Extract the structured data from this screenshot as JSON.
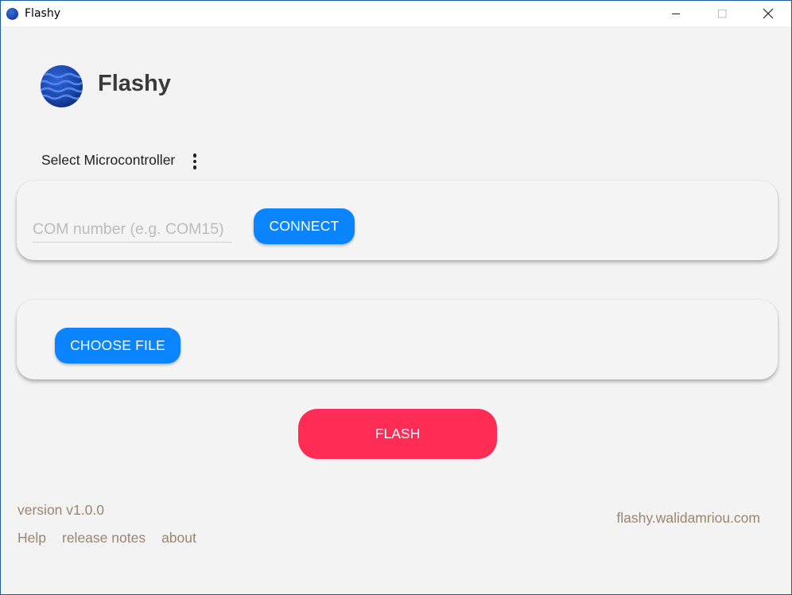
{
  "window": {
    "title": "Flashy",
    "controls": {
      "minimize_icon": "minimize-icon",
      "maximize_icon": "maximize-icon",
      "close_icon": "close-icon"
    }
  },
  "header": {
    "app_name": "Flashy",
    "logo_icon": "globe-wave-logo"
  },
  "microcontroller": {
    "label": "Select Microcontroller",
    "menu_icon": "more-vertical-icon"
  },
  "connection": {
    "com_input": {
      "value": "",
      "placeholder": "COM number (e.g. COM15)"
    },
    "connect_label": "CONNECT"
  },
  "file": {
    "choose_label": "CHOOSE FILE"
  },
  "flash": {
    "label": "FLASH"
  },
  "footer": {
    "version": "version v1.0.0",
    "links": {
      "help": "Help",
      "release_notes": "release notes",
      "about": "about"
    },
    "website": "flashy.walidamriou.com"
  },
  "colors": {
    "accent_blue": "#0a84ff",
    "flash_red": "#ff2d55",
    "footer_text": "#9a8571",
    "background": "#f3f3f3"
  }
}
